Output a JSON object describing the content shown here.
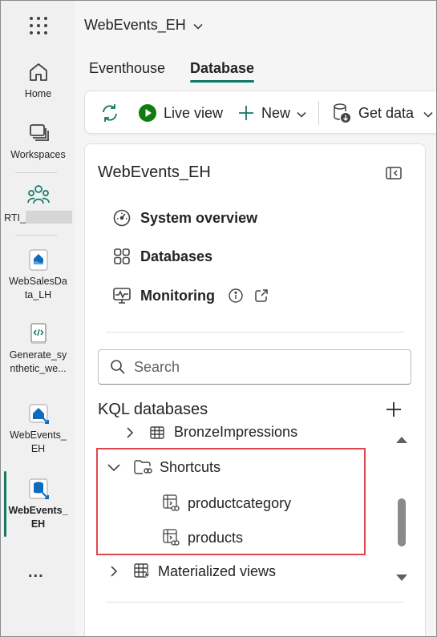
{
  "app": {
    "workspace_title": "WebEvents_EH"
  },
  "rail": {
    "items": [
      {
        "label": "Home",
        "icon": "home-icon"
      },
      {
        "label": "Workspaces",
        "icon": "workspaces-icon"
      },
      {
        "label": "RTI_",
        "icon": "rti-workspace-icon"
      },
      {
        "label_line1": "WebSalesDa",
        "label_line2": "ta_LH",
        "icon": "lakehouse-icon"
      },
      {
        "label_line1": "Generate_sy",
        "label_line2": "nthetic_we...",
        "icon": "notebook-icon"
      },
      {
        "label_line1": "WebEvents_",
        "label_line2": "EH",
        "icon": "eventhouse-icon"
      },
      {
        "label_line1": "WebEvents_",
        "label_line2": "EH",
        "icon": "kql-database-icon",
        "active": true
      }
    ],
    "more": "..."
  },
  "tabs": [
    {
      "label": "Eventhouse",
      "active": false
    },
    {
      "label": "Database",
      "active": true
    }
  ],
  "toolbar": {
    "refresh_icon": "refresh-icon",
    "live_view": "Live view",
    "new": "New",
    "get_data": "Get data"
  },
  "panel": {
    "title": "WebEvents_EH",
    "nav": [
      {
        "label": "System overview",
        "icon": "gauge-icon"
      },
      {
        "label": "Databases",
        "icon": "grid-icon"
      },
      {
        "label": "Monitoring",
        "icon": "monitor-icon"
      }
    ],
    "search_placeholder": "Search",
    "kql_title": "KQL databases",
    "tree": {
      "bronze": "BronzeImpressions",
      "shortcuts": "Shortcuts",
      "productcategory": "productcategory",
      "products": "products",
      "materialized": "Materialized views"
    }
  },
  "colors": {
    "accent": "#117865",
    "highlight": "#e0474c",
    "live_green": "#107c10"
  }
}
